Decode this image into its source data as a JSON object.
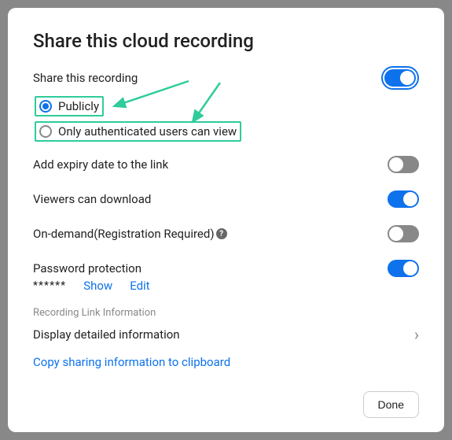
{
  "title": "Share this cloud recording",
  "share_label": "Share this recording",
  "share_enabled": true,
  "radio_options": {
    "publicly": "Publicly",
    "authenticated": "Only authenticated users can view"
  },
  "selected_radio": "publicly",
  "options": {
    "expiry": {
      "label": "Add expiry date to the link",
      "enabled": false
    },
    "download": {
      "label": "Viewers can download",
      "enabled": true
    },
    "ondemand": {
      "label": "On-demand(Registration Required)",
      "enabled": false
    },
    "password": {
      "label": "Password protection",
      "enabled": true
    }
  },
  "password_masked": "******",
  "show_label": "Show",
  "edit_label": "Edit",
  "link_section_header": "Recording Link Information",
  "detail_label": "Display detailed information",
  "copy_label": "Copy sharing information to clipboard",
  "done_label": "Done",
  "annotations": {
    "arrow1": {
      "color": "#2ECC9B"
    },
    "arrow2": {
      "color": "#2ECC9B"
    }
  }
}
